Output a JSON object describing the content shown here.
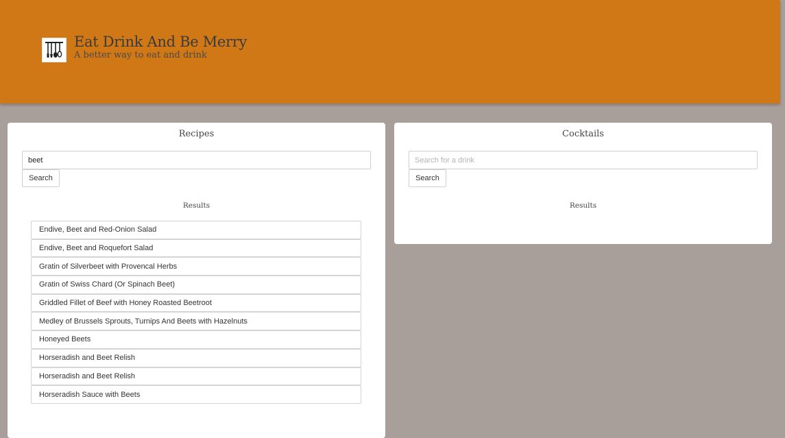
{
  "header": {
    "title": "Eat Drink And Be Merry",
    "subtitle": "A better way to eat and drink",
    "logo_icon": "kitchen-utensils-icon",
    "background": "#d07716"
  },
  "recipes": {
    "title": "Recipes",
    "search_value": "beet",
    "search_button": "Search",
    "results_label": "Results",
    "results": [
      "Endive, Beet and Red-Onion Salad",
      "Endive, Beet and Roquefort Salad",
      "Gratin of Silverbeet with Provencal Herbs",
      "Gratin of Swiss Chard (Or Spinach Beet)",
      "Griddled Fillet of Beef with Honey Roasted Beetroot",
      "Medley of Brussels Sprouts, Turnips And Beets with Hazelnuts",
      "Honeyed Beets",
      "Horseradish and Beet Relish",
      "Horseradish and Beet Relish",
      "Horseradish Sauce with Beets"
    ]
  },
  "cocktails": {
    "title": "Cocktails",
    "search_placeholder": "Search for a drink",
    "search_value": "",
    "search_button": "Search",
    "results_label": "Results",
    "results": []
  }
}
